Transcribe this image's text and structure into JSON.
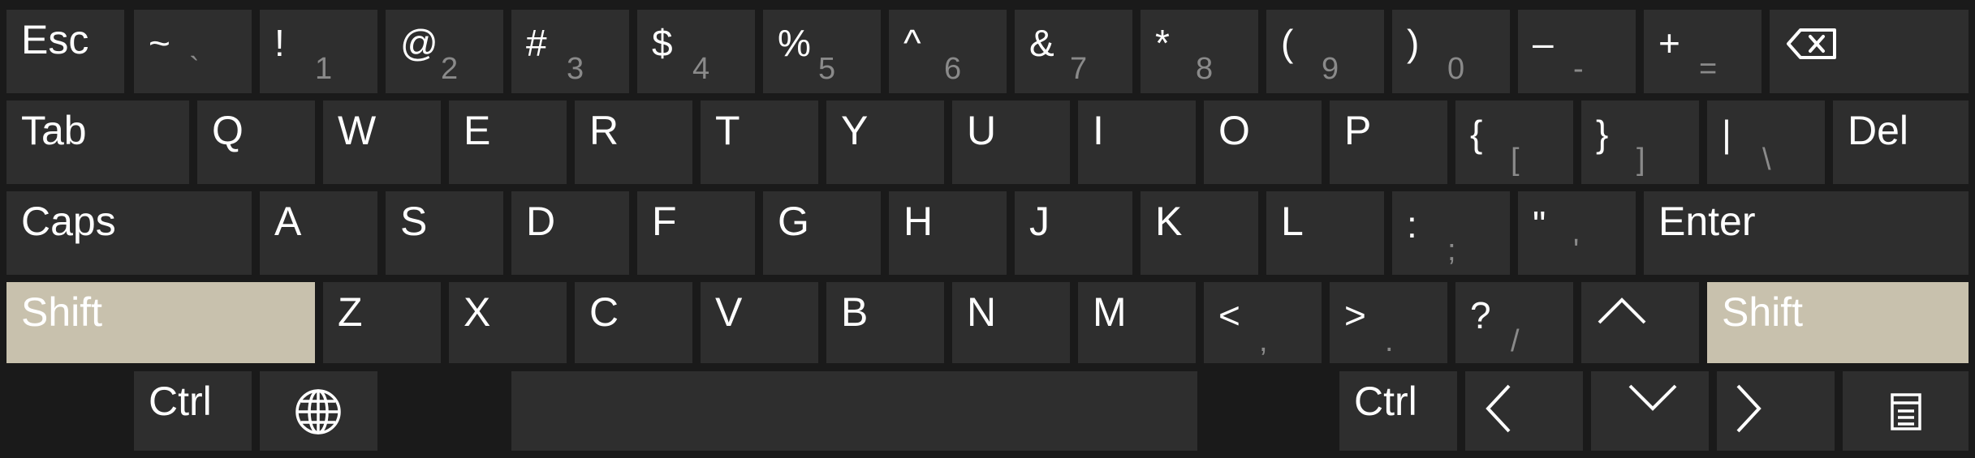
{
  "rows": [
    [
      {
        "name": "key-esc",
        "label": "Esc"
      },
      {
        "name": "key-backquote",
        "top": "~",
        "bottom": "`"
      },
      {
        "name": "key-1",
        "top": "!",
        "bottom": "1"
      },
      {
        "name": "key-2",
        "top": "@",
        "bottom": "2"
      },
      {
        "name": "key-3",
        "top": "#",
        "bottom": "3"
      },
      {
        "name": "key-4",
        "top": "$",
        "bottom": "4"
      },
      {
        "name": "key-5",
        "top": "%",
        "bottom": "5"
      },
      {
        "name": "key-6",
        "top": "^",
        "bottom": "6"
      },
      {
        "name": "key-7",
        "top": "&",
        "bottom": "7"
      },
      {
        "name": "key-8",
        "top": "*",
        "bottom": "8"
      },
      {
        "name": "key-9",
        "top": "(",
        "bottom": "9"
      },
      {
        "name": "key-0",
        "top": ")",
        "bottom": "0"
      },
      {
        "name": "key-minus",
        "top": "–",
        "bottom": "-"
      },
      {
        "name": "key-equals",
        "top": "+",
        "bottom": "="
      },
      {
        "name": "key-backspace",
        "icon": "backspace-icon"
      }
    ],
    [
      {
        "name": "key-tab",
        "label": "Tab"
      },
      {
        "name": "key-q",
        "label": "Q"
      },
      {
        "name": "key-w",
        "label": "W"
      },
      {
        "name": "key-e",
        "label": "E"
      },
      {
        "name": "key-r",
        "label": "R"
      },
      {
        "name": "key-t",
        "label": "T"
      },
      {
        "name": "key-y",
        "label": "Y"
      },
      {
        "name": "key-u",
        "label": "U"
      },
      {
        "name": "key-i",
        "label": "I"
      },
      {
        "name": "key-o",
        "label": "O"
      },
      {
        "name": "key-p",
        "label": "P"
      },
      {
        "name": "key-left-bracket",
        "top": "{",
        "bottom": "["
      },
      {
        "name": "key-right-bracket",
        "top": "}",
        "bottom": "]"
      },
      {
        "name": "key-backslash",
        "top": "|",
        "bottom": "\\"
      },
      {
        "name": "key-del",
        "label": "Del"
      }
    ],
    [
      {
        "name": "key-caps",
        "label": "Caps"
      },
      {
        "name": "key-a",
        "label": "A"
      },
      {
        "name": "key-s",
        "label": "S"
      },
      {
        "name": "key-d",
        "label": "D"
      },
      {
        "name": "key-f",
        "label": "F"
      },
      {
        "name": "key-g",
        "label": "G"
      },
      {
        "name": "key-h",
        "label": "H"
      },
      {
        "name": "key-j",
        "label": "J"
      },
      {
        "name": "key-k",
        "label": "K"
      },
      {
        "name": "key-l",
        "label": "L"
      },
      {
        "name": "key-semicolon",
        "top": ":",
        "bottom": ";"
      },
      {
        "name": "key-quote",
        "top": "\"",
        "bottom": "'"
      },
      {
        "name": "key-enter",
        "label": "Enter"
      }
    ],
    [
      {
        "name": "key-shift-left",
        "label": "Shift",
        "active": true
      },
      {
        "name": "key-z",
        "label": "Z"
      },
      {
        "name": "key-x",
        "label": "X"
      },
      {
        "name": "key-c",
        "label": "C"
      },
      {
        "name": "key-v",
        "label": "V"
      },
      {
        "name": "key-b",
        "label": "B"
      },
      {
        "name": "key-n",
        "label": "N"
      },
      {
        "name": "key-m",
        "label": "M"
      },
      {
        "name": "key-comma",
        "top": "<",
        "bottom": ","
      },
      {
        "name": "key-period",
        "top": ">",
        "bottom": "."
      },
      {
        "name": "key-slash",
        "top": "?",
        "bottom": "/"
      },
      {
        "name": "key-up",
        "icon": "chevron-up-icon"
      },
      {
        "name": "key-shift-right",
        "label": "Shift",
        "active": true
      }
    ],
    [
      {
        "name": "key-ctrl-left",
        "label": "Ctrl"
      },
      {
        "name": "key-language",
        "icon": "globe-icon"
      },
      {
        "name": "key-space",
        "label": ""
      },
      {
        "name": "key-ctrl-right",
        "label": "Ctrl"
      },
      {
        "name": "key-left",
        "icon": "chevron-left-icon"
      },
      {
        "name": "key-down",
        "icon": "chevron-down-icon"
      },
      {
        "name": "key-right",
        "icon": "chevron-right-icon"
      },
      {
        "name": "key-menu",
        "icon": "menu-icon"
      }
    ]
  ],
  "colors": {
    "background": "#1a1a1a",
    "key": "#2e2e2e",
    "key_active": "#c8c1ad",
    "text": "#ffffff",
    "secondary_text": "#8a8a8a"
  }
}
